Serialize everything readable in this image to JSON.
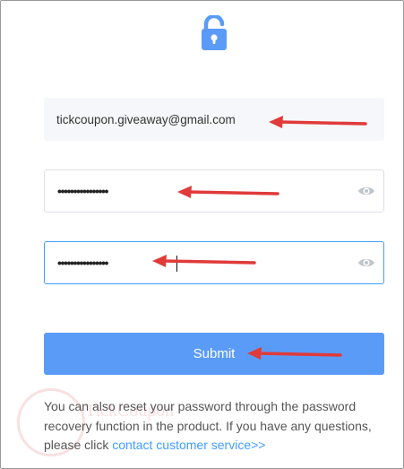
{
  "form": {
    "email_value": "tickcoupon.giveaway@gmail.com",
    "password_value": "••••••••••••••••",
    "confirm_password_value": "••••••••••••••••",
    "submit_label": "Submit"
  },
  "footer": {
    "help_text": "You can also reset your password through the password recovery function in the product. If you have any questions, please click ",
    "contact_link": "contact customer service>>"
  },
  "colors": {
    "accent": "#409eff",
    "button": "#5b9bf8",
    "annotation_arrow": "#e03a3a"
  },
  "icons": {
    "top": "lock-icon",
    "password_toggle": "eye-icon"
  }
}
